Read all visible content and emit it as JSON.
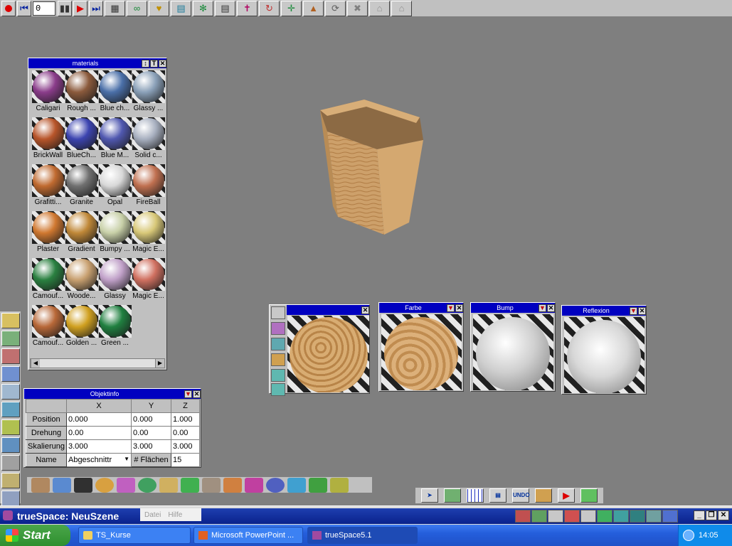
{
  "toolbar": {
    "frame_value": "0",
    "buttons": [
      "record-icon",
      "rewind-start-icon",
      "step-back-icon",
      "play-icon",
      "step-forward-icon",
      "spreadsheet-icon",
      "path-icon",
      "key-icon",
      "view-icon",
      "tube-icon",
      "report-icon",
      "axes-icon",
      "rotate-icon",
      "move-axes-icon",
      "object-icon",
      "undo-view-icon",
      "scale-icon",
      "house-icon",
      "house-alt-icon"
    ]
  },
  "materials": {
    "title": "materials",
    "items": [
      {
        "label": "Caligari",
        "color": "#8a3c8a"
      },
      {
        "label": "Rough ...",
        "color": "#8b5a3c"
      },
      {
        "label": "Blue ch...",
        "color": "#4a6fa8"
      },
      {
        "label": "Glassy ...",
        "color": "#8aa0b8"
      },
      {
        "label": "BrickWall",
        "color": "#b8552a"
      },
      {
        "label": "BlueCh...",
        "color": "#3c44b0"
      },
      {
        "label": "Blue M...",
        "color": "#5058b0"
      },
      {
        "label": "Solid c...",
        "color": "#a8b0c0"
      },
      {
        "label": "Grafitti...",
        "color": "#c06a30"
      },
      {
        "label": "Granite",
        "color": "#707070"
      },
      {
        "label": "Opal",
        "color": "#d8d8d8"
      },
      {
        "label": "FireBall",
        "color": "#c07050"
      },
      {
        "label": "Plaster",
        "color": "#d07830"
      },
      {
        "label": "Gradient",
        "color": "#c08838"
      },
      {
        "label": "Bumpy ...",
        "color": "#c8d0a8"
      },
      {
        "label": "Magic E...",
        "color": "#d8c878"
      },
      {
        "label": "Camouf...",
        "color": "#2a8040"
      },
      {
        "label": "Woode...",
        "color": "#c8a070"
      },
      {
        "label": "Glassy",
        "color": "#c0a0c8"
      },
      {
        "label": "Magic E...",
        "color": "#d07060"
      },
      {
        "label": "Camouf...",
        "color": "#b86838"
      },
      {
        "label": "Golden ...",
        "color": "#d0a020"
      },
      {
        "label": "Green ...",
        "color": "#208040"
      }
    ]
  },
  "previews": {
    "farbe": "Farbe",
    "bump": "Bump",
    "reflexion": "Reflexion"
  },
  "objektinfo": {
    "title": "Objektinfo",
    "headers": [
      "X",
      "Y",
      "Z"
    ],
    "rows": [
      {
        "label": "Position",
        "values": [
          "0.000",
          "0.000",
          "1.000"
        ]
      },
      {
        "label": "Drehung",
        "values": [
          "0.00",
          "0.00",
          "0.00"
        ]
      },
      {
        "label": "Skalierung",
        "values": [
          "3.000",
          "3.000",
          "3.000"
        ]
      }
    ],
    "name_label": "Name",
    "name_value": "Abgeschnittr",
    "faces_label": "# Flächen",
    "faces_value": "15"
  },
  "nav": {
    "undo_label": "UNDO"
  },
  "appbar": {
    "title": "trueSpace: NeuSzene",
    "menu": [
      "Datei",
      "Hilfe"
    ]
  },
  "taskbar": {
    "start_label": "Start",
    "tasks": [
      "TS_Kurse",
      "Microsoft PowerPoint ...",
      "trueSpace5.1"
    ],
    "clock": "14:05"
  }
}
